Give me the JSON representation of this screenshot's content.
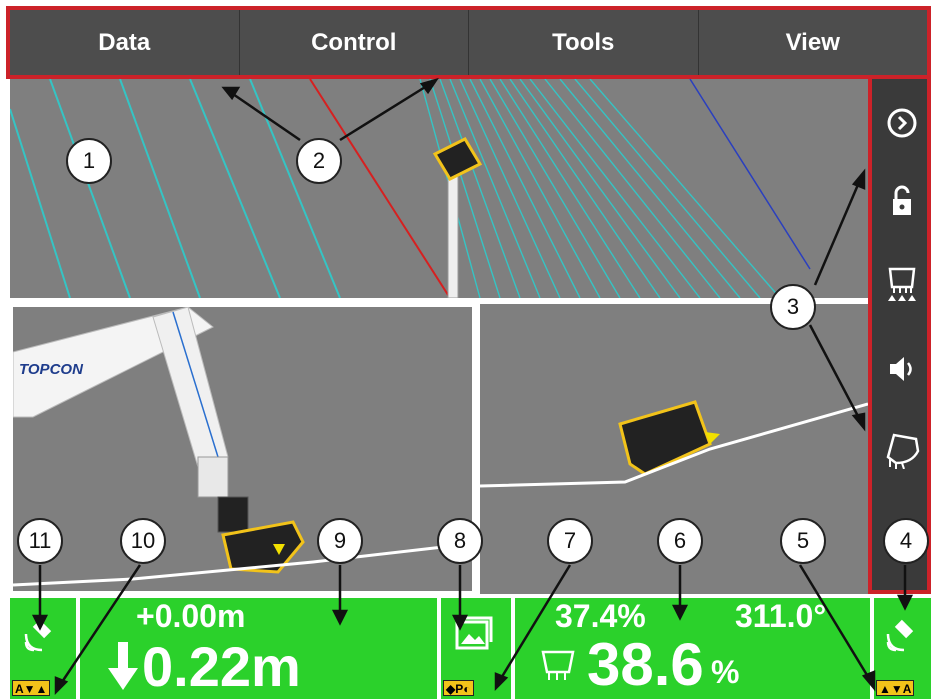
{
  "menu": {
    "data_label": "Data",
    "control_label": "Control",
    "tools_label": "Tools",
    "view_label": "View"
  },
  "brand": {
    "logo_text": "TOPCON"
  },
  "status": {
    "elevation_offset": "+0.00m",
    "cut_fill": "0.22m",
    "slope_top": "37.4%",
    "heading": "311.0°",
    "slope_main": "38.6",
    "slope_unit": "%",
    "mode_badge_left": "A",
    "mode_badge_right": "A",
    "p_badge": "P"
  },
  "callouts": [
    "1",
    "2",
    "3",
    "4",
    "5",
    "6",
    "7",
    "8",
    "9",
    "10",
    "11"
  ],
  "colors": {
    "frame_red": "#cc2229",
    "status_green": "#2bd12b",
    "menu_gray": "#4d4d4d",
    "view_gray": "#7f7f7f",
    "bucket_yellow": "#f2c31a"
  },
  "icons": {
    "toolbar": [
      "chevron-right-circle-icon",
      "lock-icon",
      "bucket-teeth-icon",
      "speaker-icon",
      "bucket-icon"
    ],
    "status": [
      "satellite-icon",
      "image-icon"
    ]
  }
}
